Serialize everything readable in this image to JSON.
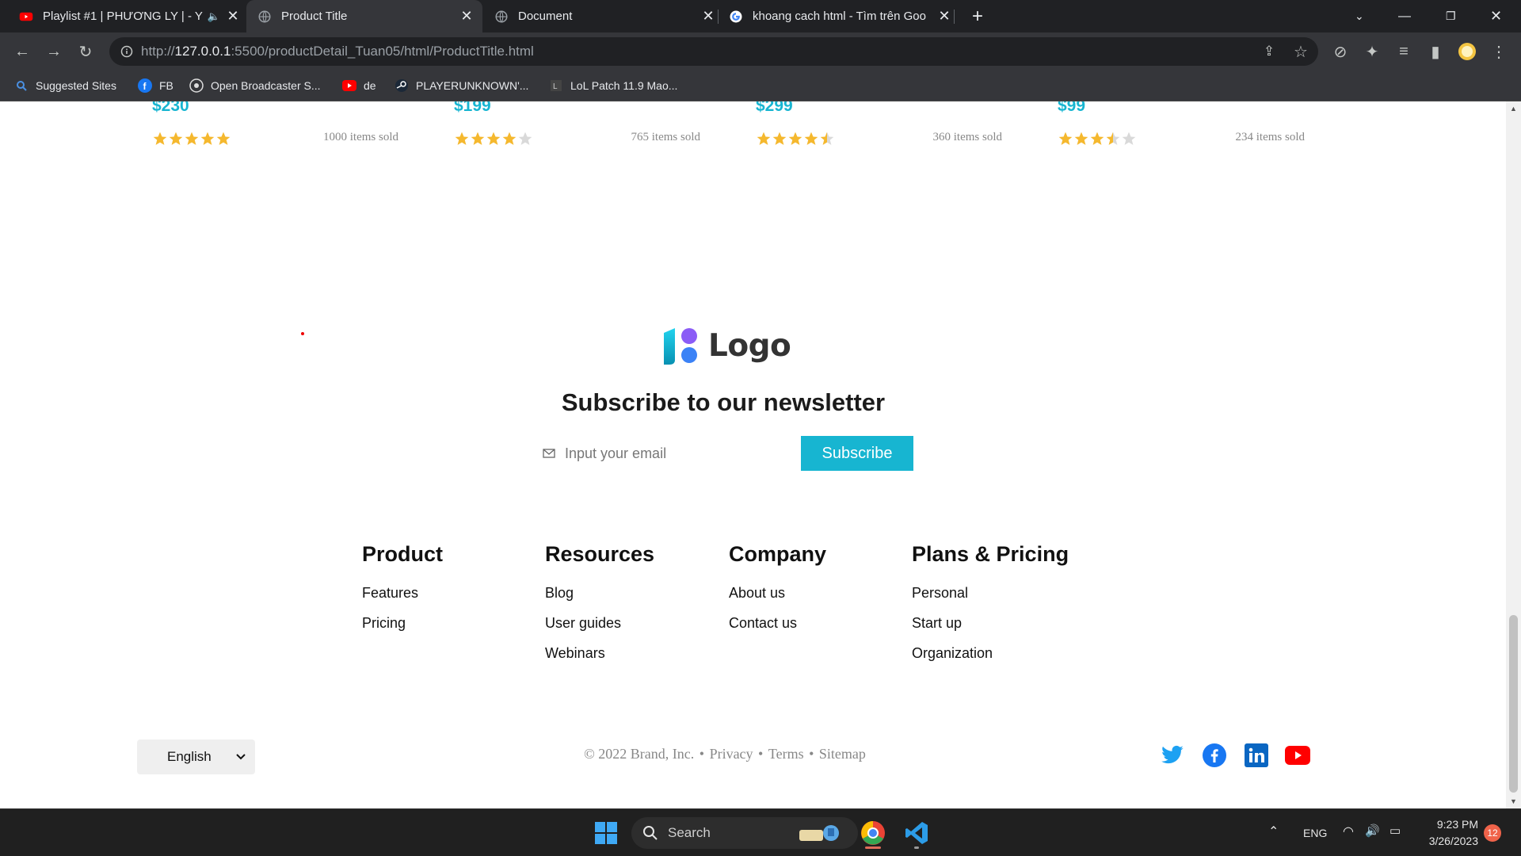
{
  "browser": {
    "tabs": [
      {
        "title": "Playlist #1 | PHƯƠNG LY | - Y",
        "active": false
      },
      {
        "title": "Product Title",
        "active": true
      },
      {
        "title": "Document",
        "active": false
      },
      {
        "title": "khoang cach html - Tìm trên Goo",
        "active": false
      }
    ],
    "new_tab": "+",
    "url_prefix": "http://",
    "url_host": "127.0.0.1",
    "url_path": ":5500/productDetail_Tuan05/html/ProductTitle.html",
    "bookmarks": [
      {
        "label": "Suggested Sites"
      },
      {
        "label": "FB"
      },
      {
        "label": "Open Broadcaster S..."
      },
      {
        "label": "de"
      },
      {
        "label": "PLAYERUNKNOWN'..."
      },
      {
        "label": "LoL Patch 11.9 Mao..."
      }
    ]
  },
  "products": [
    {
      "price": "$230",
      "rating": 5,
      "sold": "1000 items sold"
    },
    {
      "price": "$199",
      "rating": 4,
      "sold": "765 items sold"
    },
    {
      "price": "$299",
      "rating": 4.5,
      "sold": "360 items sold"
    },
    {
      "price": "$99",
      "rating": 3.5,
      "sold": "234 items sold"
    }
  ],
  "footer": {
    "logo_text": "Logo",
    "newsletter_title": "Subscribe to our newsletter",
    "email_placeholder": "Input your email",
    "subscribe_label": "Subscribe",
    "columns": [
      {
        "heading": "Product",
        "links": [
          "Features",
          "Pricing"
        ]
      },
      {
        "heading": "Resources",
        "links": [
          "Blog",
          "User guides",
          "Webinars"
        ]
      },
      {
        "heading": "Company",
        "links": [
          "About us",
          "Contact us"
        ]
      },
      {
        "heading": "Plans & Pricing",
        "links": [
          "Personal",
          "Start up",
          "Organization"
        ]
      }
    ],
    "language": "English",
    "copyright": "© 2022 Brand, Inc.",
    "legal_links": [
      "Privacy",
      "Terms",
      "Sitemap"
    ],
    "social": [
      "twitter-icon",
      "facebook-icon",
      "linkedin-icon",
      "youtube-icon"
    ]
  },
  "taskbar": {
    "search_label": "Search",
    "lang": "ENG",
    "time": "9:23 PM",
    "date": "3/26/2023",
    "notifications": "12"
  },
  "colors": {
    "accent": "#17b5d1",
    "star": "#f5b82e",
    "star_empty": "#d9d9d9"
  }
}
